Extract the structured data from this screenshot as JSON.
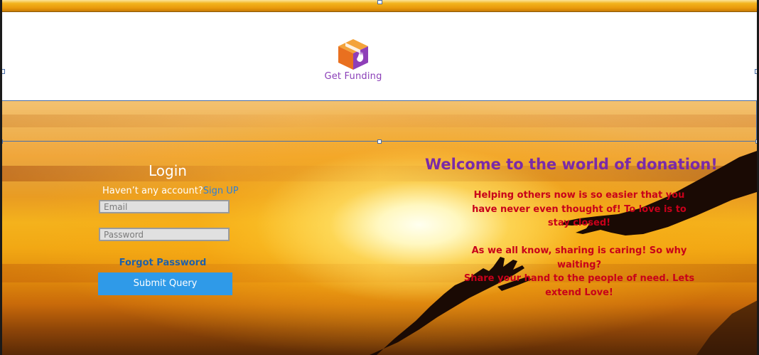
{
  "logo": {
    "text": "Get Funding",
    "icon": "gift-box-hand-icon"
  },
  "login": {
    "title": "Login",
    "account_prompt": "Haven’t any account?",
    "signup_label": "Sign UP",
    "email_placeholder": "Email",
    "password_placeholder": "Password",
    "forgot_label": "Forgot Password",
    "submit_label": "Submit  Query"
  },
  "welcome": {
    "title": "Welcome to the world of donation!",
    "message1": "Helping others now is so easier that you have never even thought of! To love is to stay closed!",
    "message2": "As we all know, sharing is caring! So why waiting?",
    "message3": "Share your hand to the people of need.  Lets extend Love!"
  },
  "colors": {
    "accent_purple": "#7a2aa8",
    "message_red": "#c8001a",
    "button_blue": "#2f9ae8",
    "link_blue": "#1f5fa8"
  }
}
